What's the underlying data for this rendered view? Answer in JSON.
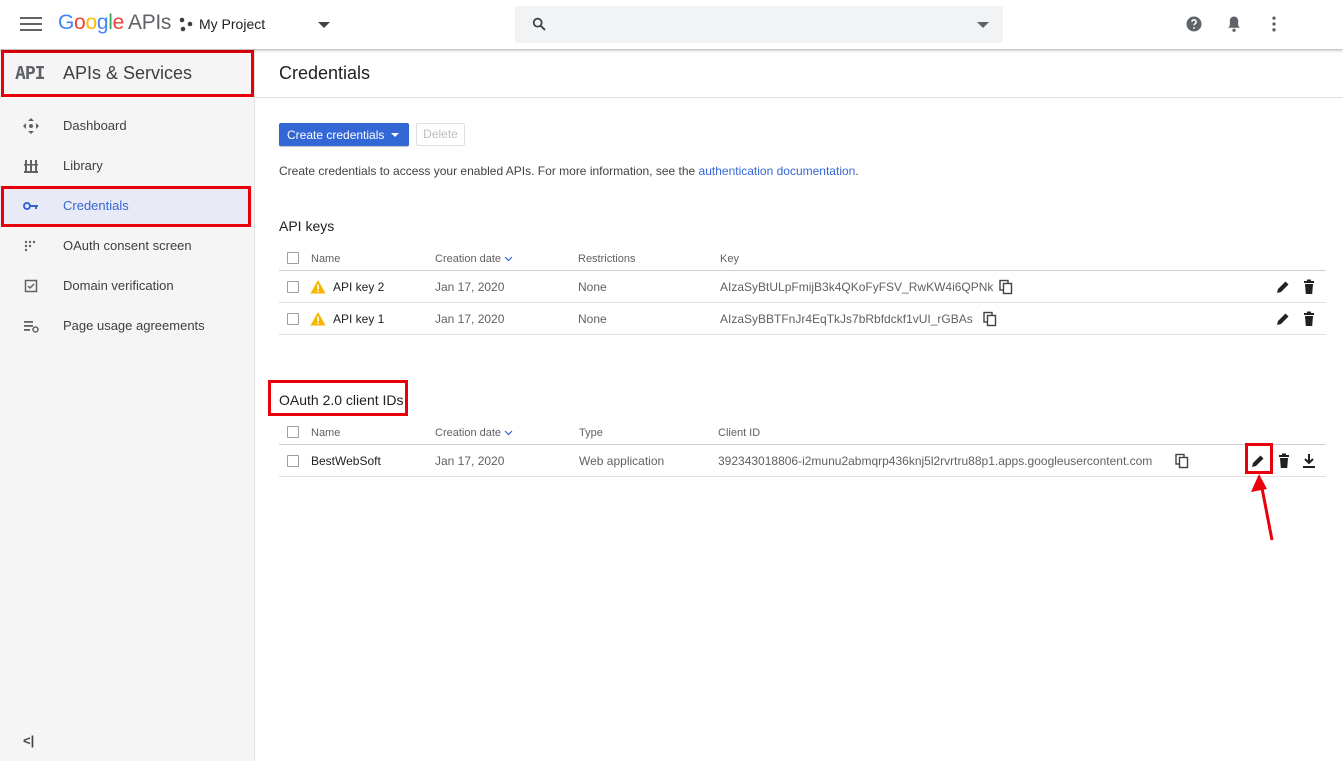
{
  "topbar": {
    "logo_google": [
      "G",
      "o",
      "o",
      "g",
      "l",
      "e"
    ],
    "logo_apis": "APIs",
    "project_name": "My Project"
  },
  "sidebar": {
    "header_logo": "API",
    "header_title": "APIs & Services",
    "items": [
      {
        "label": "Dashboard",
        "icon": "dashboard-icon"
      },
      {
        "label": "Library",
        "icon": "library-icon"
      },
      {
        "label": "Credentials",
        "icon": "key-icon",
        "active": true
      },
      {
        "label": "OAuth consent screen",
        "icon": "oauth-consent-icon"
      },
      {
        "label": "Domain verification",
        "icon": "domain-verification-icon"
      },
      {
        "label": "Page usage agreements",
        "icon": "page-usage-icon"
      }
    ],
    "collapse_label": "<|"
  },
  "main": {
    "title": "Credentials",
    "create_button": "Create credentials",
    "delete_button": "Delete",
    "info_text": "Create credentials to access your enabled APIs. For more information, see the ",
    "info_link": "authentication documentation",
    "info_end": ".",
    "api_keys": {
      "title": "API keys",
      "columns": {
        "name": "Name",
        "date": "Creation date",
        "restrictions": "Restrictions",
        "key": "Key"
      },
      "rows": [
        {
          "name": "API key 2",
          "date": "Jan 17, 2020",
          "restrictions": "None",
          "key": "AIzaSyBtULpFmijB3k4QKoFyFSV_RwKW4i6QPNk"
        },
        {
          "name": "API key 1",
          "date": "Jan 17, 2020",
          "restrictions": "None",
          "key": "AIzaSyBBTFnJr4EqTkJs7bRbfdckf1vUI_rGBAs"
        }
      ]
    },
    "oauth": {
      "title": "OAuth 2.0 client IDs",
      "columns": {
        "name": "Name",
        "date": "Creation date",
        "type": "Type",
        "client_id": "Client ID"
      },
      "rows": [
        {
          "name": "BestWebSoft",
          "date": "Jan 17, 2020",
          "type": "Web application",
          "client_id": "392343018806-i2munu2abmqrp436knj5l2rvrtru88p1.apps.googleusercontent.com"
        }
      ]
    }
  },
  "colors": {
    "accent": "#3367d6",
    "annotation": "#e8000b",
    "warning": "#f4b400"
  }
}
